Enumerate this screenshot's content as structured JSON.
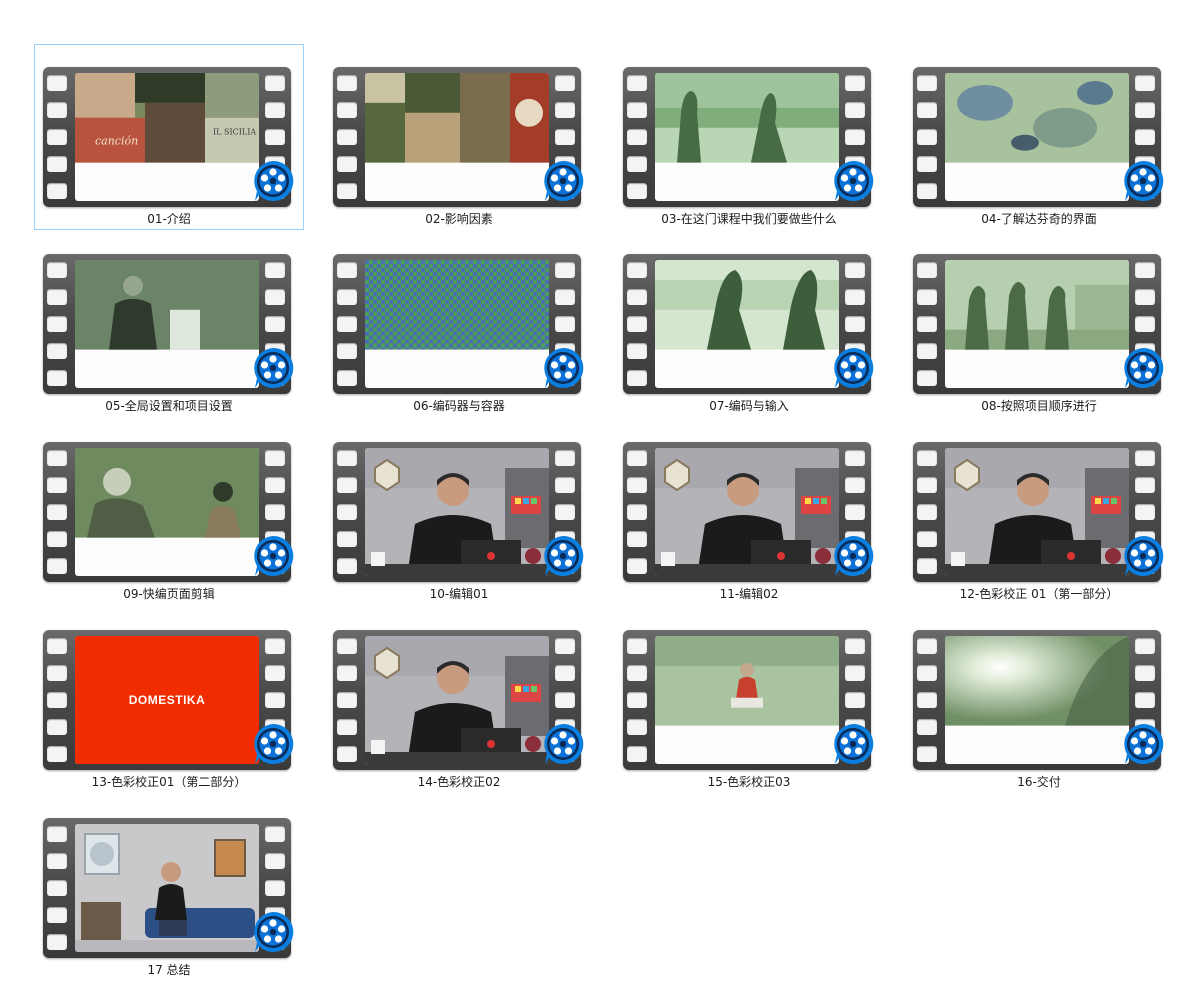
{
  "folder": {
    "items": [
      {
        "label": "01-介绍",
        "thumbnail": "collage-posters",
        "selected": true
      },
      {
        "label": "02-影响因素",
        "thumbnail": "collage-film-stills",
        "selected": false
      },
      {
        "label": "03-在这门课程中我们要做些什么",
        "thumbnail": "silhouettes-beach",
        "selected": false
      },
      {
        "label": "04-了解达芬奇的界面",
        "thumbnail": "textured-painting",
        "selected": false
      },
      {
        "label": "05-全局设置和项目设置",
        "thumbnail": "man-in-suit",
        "selected": false
      },
      {
        "label": "06-编码器与容器",
        "thumbnail": "checkerboard-pattern",
        "selected": false
      },
      {
        "label": "07-编码与输入",
        "thumbnail": "dancing-silhouettes",
        "selected": false
      },
      {
        "label": "08-按照项目顺序进行",
        "thumbnail": "people-walking",
        "selected": false
      },
      {
        "label": "09-快编页面剪辑",
        "thumbnail": "two-people-scene",
        "selected": false
      },
      {
        "label": "10-编辑01",
        "thumbnail": "instructor-at-desk",
        "selected": false
      },
      {
        "label": "11-编辑02",
        "thumbnail": "instructor-at-desk",
        "selected": false
      },
      {
        "label": "12-色彩校正 01（第一部分）",
        "thumbnail": "instructor-at-desk",
        "selected": false
      },
      {
        "label": "13-色彩校正01（第二部分）",
        "thumbnail": "domestika-logo",
        "selected": false,
        "logo_text": "DOMESTIKA"
      },
      {
        "label": "14-色彩校正02",
        "thumbnail": "instructor-at-desk",
        "selected": false
      },
      {
        "label": "15-色彩校正03",
        "thumbnail": "child-outdoor",
        "selected": false
      },
      {
        "label": "16-交付",
        "thumbnail": "sun-flare",
        "selected": false
      },
      {
        "label": "17 总结",
        "thumbnail": "instructor-on-sofa",
        "selected": false
      }
    ]
  },
  "icons": {
    "file_type_icon": "video-player-badge-icon",
    "thumbnail_frame": "film-strip-icon"
  },
  "colors": {
    "selection_border": "#99d1ff",
    "badge_blue": "#0a7fe0",
    "domestika_red": "#f02c00"
  }
}
